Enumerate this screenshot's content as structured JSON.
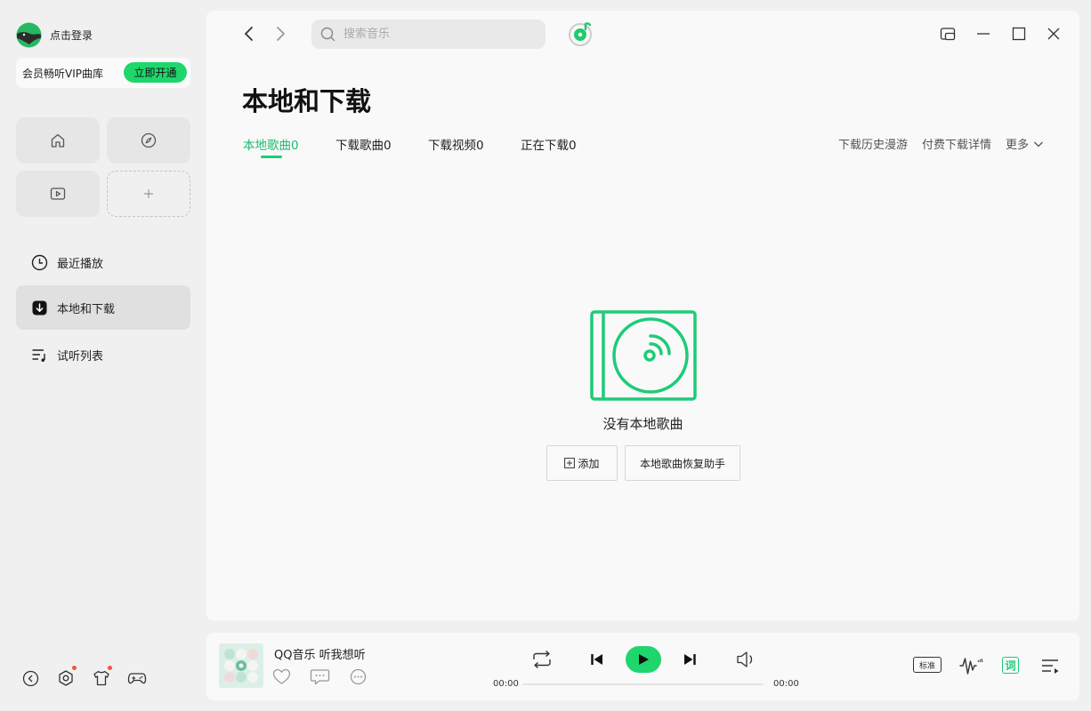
{
  "user": {
    "login_label": "点击登录",
    "vip_text": "会员畅听VIP曲库",
    "vip_button": "立即开通"
  },
  "sidebar": {
    "tiles": [
      {
        "icon": "home-icon"
      },
      {
        "icon": "compass-icon"
      },
      {
        "icon": "video-icon"
      },
      {
        "icon": "plus-icon"
      }
    ],
    "items": [
      {
        "label": "最近播放",
        "icon": "clock-icon"
      },
      {
        "label": "本地和下载",
        "icon": "download-icon",
        "active": true
      },
      {
        "label": "试听列表",
        "icon": "playlist-icon"
      }
    ],
    "bottom_icons": [
      "back-circle-icon",
      "plugin-icon",
      "skin-icon",
      "gamepad-icon"
    ]
  },
  "topbar": {
    "search_placeholder": "搜索音乐"
  },
  "page": {
    "title": "本地和下载",
    "tabs": [
      {
        "label": "本地歌曲0",
        "active": true
      },
      {
        "label": "下载歌曲0"
      },
      {
        "label": "下载视频0"
      },
      {
        "label": "正在下载0"
      }
    ],
    "right_links": {
      "history": "下载历史漫游",
      "paid": "付费下载详情",
      "more": "更多"
    },
    "empty": {
      "message": "没有本地歌曲",
      "add_button": "添加",
      "restore_button": "本地歌曲恢复助手"
    }
  },
  "player": {
    "song_title": "QQ音乐 听我想听",
    "current_time": "00:00",
    "total_time": "00:00",
    "progress": 0,
    "quality": "标准",
    "lyric_button": "词"
  },
  "colors": {
    "accent": "#1ed66c",
    "tab_active": "#1dbb73",
    "badge": "#f5533d"
  }
}
